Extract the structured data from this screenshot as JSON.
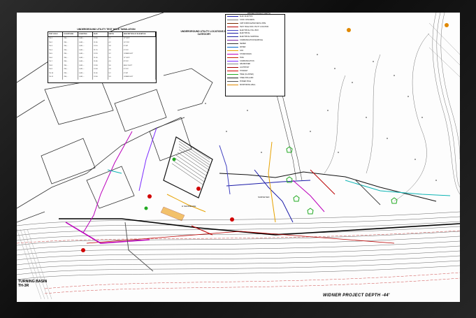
{
  "drawing": {
    "basin_label": "TURNING BASIN",
    "basin_sub": "TH-3R",
    "project_label": "WIDNER PROJECT DEPTH -44'",
    "stamp": "WIDNER PROJECT DEPTH",
    "sub_label_1": "H SHORELINE",
    "sub_label_2": "SURVEYED"
  },
  "test_hole_table": {
    "title": "UNDERGROUND UTILITY TEST HOLE TABULATION",
    "headers": [
      "TEST HOLE",
      "E NORTHING",
      "E EASTING",
      "ELEV",
      "DEPTH",
      "DESCRIPTION OF ELEVATION"
    ],
    "rows": [
      [
        "TH-1",
        "760,...",
        "1,441,...",
        "12.40",
        "5.1",
        "12\" RCP"
      ],
      [
        "TH-2",
        "760,...",
        "1,441,...",
        "11.90",
        "4.2",
        "10\" PVC"
      ],
      [
        "TH-3",
        "760,...",
        "1,441,...",
        "12.10",
        "3.8",
        "6\" DIP"
      ],
      [
        "TH-4",
        "760,...",
        "1,441,...",
        "11.70",
        "4.6",
        "4\" PVC"
      ],
      [
        "TH-5",
        "760,...",
        "1,441,...",
        "12.20",
        "3.2",
        "COMM DUCT"
      ],
      [
        "TH-6",
        "760,...",
        "1,441,...",
        "11.50",
        "5.5",
        "12\" RCP"
      ],
      [
        "TH-7",
        "760,...",
        "1,441,...",
        "11.80",
        "4.0",
        "8\" PVC"
      ],
      [
        "TH-8",
        "760,...",
        "1,441,...",
        "12.30",
        "3.6",
        "ELEC DUCT"
      ],
      [
        "TH-9",
        "760,...",
        "1,441,...",
        "12.00",
        "4.8",
        "6\" PVC"
      ],
      [
        "TH-10",
        "760,...",
        "1,441,...",
        "11.60",
        "5.2",
        "4\" DIP"
      ],
      [
        "TH-11",
        "760,...",
        "1,441,...",
        "12.50",
        "3.9",
        "COMM DUCT"
      ]
    ]
  },
  "locations_title": "UNDERGROUND UTILITY LOCATIONS BY CATEGORY",
  "legend": {
    "items": [
      {
        "label": "ELEC ELECTRIC",
        "color": "#1a1aa8"
      },
      {
        "label": "CONC CONCRETE",
        "color": "#777777"
      },
      {
        "label": "CMP CORRUGATED METAL PIPE",
        "color": "#7a2a00"
      },
      {
        "label": "TEST HOLE FOR UTILITY LOCATION",
        "color": "#b80000"
      },
      {
        "label": "ELECTRICAL PULL BOX",
        "color": "#4040c0"
      },
      {
        "label": "ELECTRICAL",
        "color": "#1a1aa8"
      },
      {
        "label": "ELECTRICAL MANHOLE",
        "color": "#2020a0"
      },
      {
        "label": "COMMUNICATION MANHOLE",
        "color": "#7b1fa2"
      },
      {
        "label": "SEWER",
        "color": "#333333"
      },
      {
        "label": "WATER",
        "color": "#0066cc"
      },
      {
        "label": "GAS",
        "color": "#e6a100"
      },
      {
        "label": "STORM DRAIN",
        "color": "#bb00bb"
      },
      {
        "label": "FUEL",
        "color": "#cc2200"
      },
      {
        "label": "COMMUNICATION",
        "color": "#7a2aff"
      },
      {
        "label": "ABANDONED",
        "color": "#888888"
      },
      {
        "label": "LIGHTPOST",
        "color": "#aa0000"
      },
      {
        "label": "HYDRANT",
        "color": "#d10000"
      },
      {
        "label": "TREE (CLUSTER)",
        "color": "#22aa22"
      },
      {
        "label": "STEEL BOLLARD",
        "color": "#222222"
      },
      {
        "label": "POWER POLE",
        "color": "#555555"
      },
      {
        "label": "MONITORING WELL",
        "color": "#e08800"
      }
    ]
  }
}
